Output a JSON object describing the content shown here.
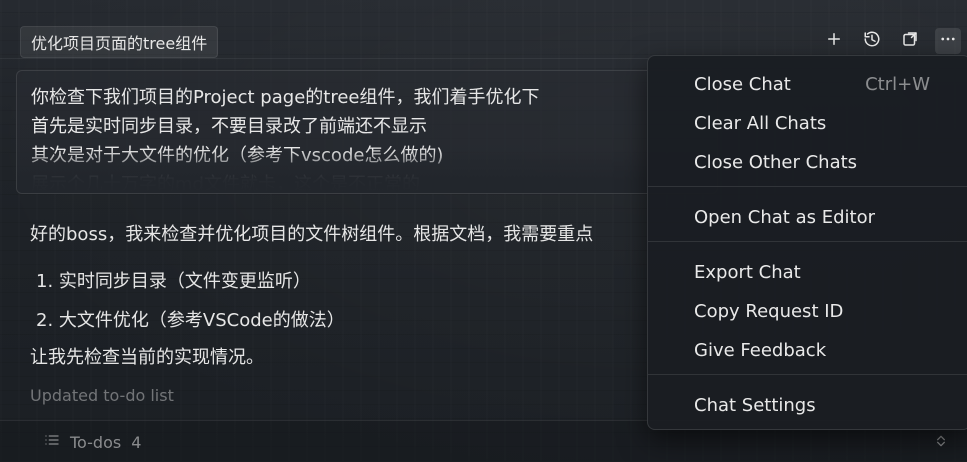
{
  "header": {
    "chat_title": "优化项目页面的tree组件"
  },
  "top_actions": {
    "new_chat": "plus-icon",
    "history": "history-icon",
    "new_window": "new-window-icon",
    "more": "more-icon"
  },
  "user_message": {
    "lines": [
      "你检查下我们项目的Project page的tree组件，我们着手优化下",
      "首先是实时同步目录，不要目录改了前端还不显示",
      "其次是对于大文件的优化（参考下vscode怎么做的)",
      "展示个几十万字的md文件就卡，这个是不正常的"
    ]
  },
  "assistant": {
    "intro": "好的boss，我来检查并优化项目的文件树组件。根据文档，我需要重点",
    "list": [
      "1. 实时同步目录（文件变更监听）",
      "2. 大文件优化（参考VSCode的做法）"
    ],
    "next": "让我先检查当前的实现情况。"
  },
  "status": {
    "text": "Updated to-do list"
  },
  "todos": {
    "label": "To-dos",
    "count": "4"
  },
  "menu": {
    "items": [
      {
        "label": "Close Chat",
        "shortcut": "Ctrl+W"
      },
      {
        "label": "Clear All Chats"
      },
      {
        "label": "Close Other Chats"
      },
      {
        "label": "Open Chat as Editor"
      },
      {
        "label": "Export Chat"
      },
      {
        "label": "Copy Request ID"
      },
      {
        "label": "Give Feedback"
      },
      {
        "label": "Chat Settings"
      }
    ]
  }
}
